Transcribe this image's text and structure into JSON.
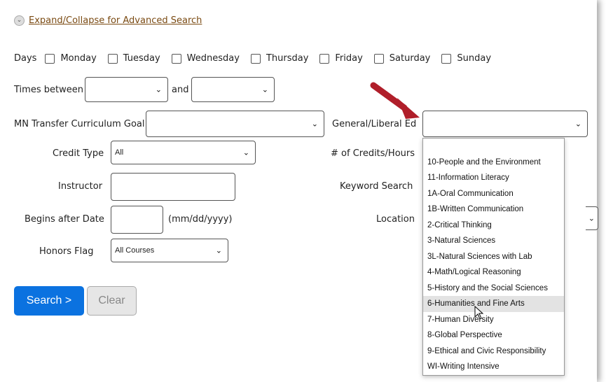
{
  "advanced_search_link": "Expand/Collapse for Advanced Search",
  "days": {
    "label": "Days",
    "options": [
      "Monday",
      "Tuesday",
      "Wednesday",
      "Thursday",
      "Friday",
      "Saturday",
      "Sunday"
    ]
  },
  "times": {
    "label": "Times between",
    "and_label": "and",
    "start_value": "",
    "end_value": ""
  },
  "mn_transfer": {
    "label": "MN Transfer Curriculum Goal",
    "value": ""
  },
  "gen_lib_ed": {
    "label": "General/Liberal Ed",
    "value": ""
  },
  "credit_type": {
    "label": "Credit Type",
    "value": "All"
  },
  "credits_hours": {
    "label": "# of Credits/Hours"
  },
  "instructor": {
    "label": "Instructor",
    "value": ""
  },
  "keyword": {
    "label": "Keyword Search"
  },
  "begins_after": {
    "label": "Begins after Date",
    "hint": "(mm/dd/yyyy)",
    "value": ""
  },
  "location": {
    "label": "Location"
  },
  "honors": {
    "label": "Honors Flag",
    "value": "All Courses"
  },
  "buttons": {
    "search": "Search >",
    "clear": "Clear"
  },
  "dropdown_options": [
    "",
    "10-People and the Environment",
    "11-Information Literacy",
    "1A-Oral Communication",
    "1B-Written Communication",
    "2-Critical Thinking",
    "3-Natural Sciences",
    "3L-Natural Sciences with Lab",
    "4-Math/Logical Reasoning",
    "5-History and the Social Sciences",
    "6-Humanities and Fine Arts",
    "7-Human Diversity",
    "8-Global Perspective",
    "9-Ethical and Civic Responsibility",
    "WI-Writing Intensive"
  ],
  "highlighted_option": "6-Humanities and Fine Arts",
  "colors": {
    "link": "#7a4a12",
    "search_button": "#0b72e0",
    "arrow": "#b01e2a",
    "highlight": "#e3e3e3"
  }
}
